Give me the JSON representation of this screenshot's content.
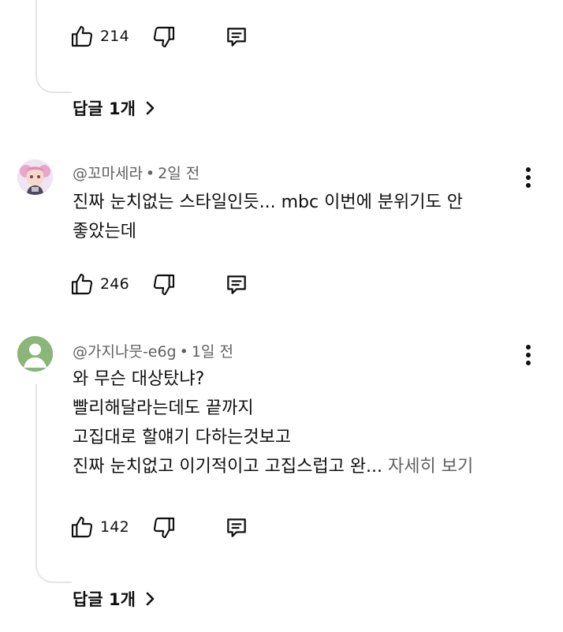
{
  "thread1": {
    "like_count": "214",
    "replies_label": "답글 1개"
  },
  "comments": [
    {
      "handle": "@꼬마세라",
      "time": "2일 전",
      "lines": [
        "진짜 눈치없는 스타일인듯... mbc 이번에 분위기도 안",
        "좋았는데"
      ],
      "like_count": "246",
      "avatar": "anime-character-avatar"
    },
    {
      "handle": "@가지나뭇-e6g",
      "time": "1일 전",
      "lines": [
        "와 무슨 대상탔냐?",
        "빨리해달라는데도 끝까지",
        "고집대로 할얘기 다하는것보고",
        "진짜 눈치없고 이기적이고 고집스럽고 완..."
      ],
      "more_label": "자세히 보기",
      "like_count": "142",
      "replies_label": "답글 1개",
      "avatar": "default-user-avatar"
    }
  ],
  "separator": "•",
  "icons": [
    "thumbs-up-icon",
    "thumbs-down-icon",
    "reply-icon",
    "chevron-right-icon",
    "more-vert-icon"
  ],
  "colors": {
    "text": "#0f0f0f",
    "secondary": "#606060",
    "thread_line": "#e5e5e5",
    "default_avatar": "#8ab67a"
  }
}
